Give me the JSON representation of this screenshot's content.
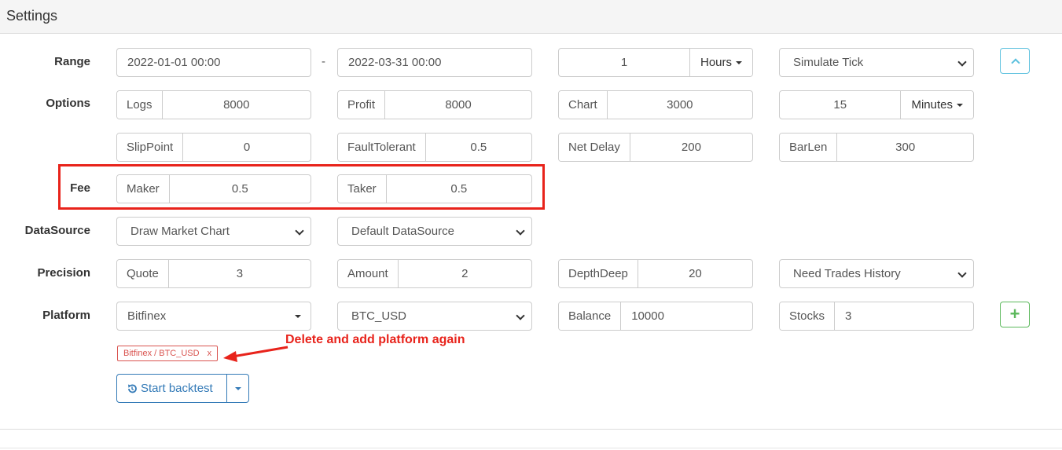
{
  "panel": {
    "title": "Settings"
  },
  "rows": {
    "range": {
      "label": "Range",
      "start": "2022-01-01 00:00",
      "separator": "-",
      "end": "2022-03-31 00:00",
      "period_value": "1",
      "period_unit": "Hours",
      "mode": "Simulate Tick"
    },
    "options": {
      "label": "Options",
      "logs_label": "Logs",
      "logs_value": "8000",
      "profit_label": "Profit",
      "profit_value": "8000",
      "chart_label": "Chart",
      "chart_value": "3000",
      "kline_value": "15",
      "kline_unit": "Minutes",
      "slippoint_label": "SlipPoint",
      "slippoint_value": "0",
      "faulttolerant_label": "FaultTolerant",
      "faulttolerant_value": "0.5",
      "netdelay_label": "Net Delay",
      "netdelay_value": "200",
      "barlen_label": "BarLen",
      "barlen_value": "300"
    },
    "fee": {
      "label": "Fee",
      "maker_label": "Maker",
      "maker_value": "0.5",
      "taker_label": "Taker",
      "taker_value": "0.5"
    },
    "datasource": {
      "label": "DataSource",
      "chart_select": "Draw Market Chart",
      "source_select": "Default DataSource"
    },
    "precision": {
      "label": "Precision",
      "quote_label": "Quote",
      "quote_value": "3",
      "amount_label": "Amount",
      "amount_value": "2",
      "depth_label": "DepthDeep",
      "depth_value": "20",
      "trades_select": "Need Trades History"
    },
    "platform": {
      "label": "Platform",
      "exchange": "Bitfinex",
      "pair": "BTC_USD",
      "balance_label": "Balance",
      "balance_value": "10000",
      "stocks_label": "Stocks",
      "stocks_value": "3",
      "add_symbol": "+"
    }
  },
  "platform_tag": {
    "text": "Bitfinex / BTC_USD",
    "remove": "x"
  },
  "annotation": {
    "text": "Delete and add platform again",
    "color": "#e8231b"
  },
  "actions": {
    "start_label": "Start backtest"
  },
  "colors": {
    "highlight": "#e8231b",
    "primary": "#337ab7",
    "info": "#5bc0de",
    "success": "#5cb85c",
    "danger": "#d9534f"
  }
}
